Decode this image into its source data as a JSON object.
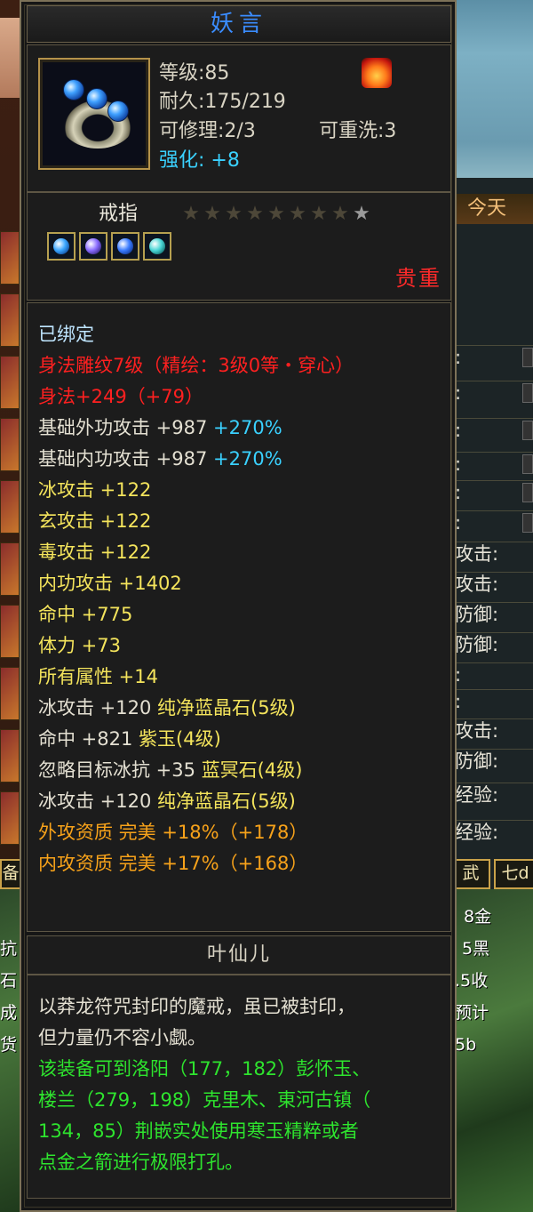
{
  "item": {
    "name": "妖言",
    "level_label": "等级:85",
    "durability_label": "耐久:175/219",
    "repair_label": "可修理:2/3",
    "rewash_label": "可重洗:3",
    "enhance_label": "强化:",
    "enhance_value": "+8",
    "type": "戒指",
    "star_rating": {
      "filled": 0,
      "total": 9
    },
    "rarity": "贵重",
    "socket_colors": [
      "#3aa6ff",
      "#8a6cff",
      "#3a7cff",
      "#4ad6d6"
    ]
  },
  "stats": {
    "bound": "已绑定",
    "engrave": "身法雕纹7级（精绘：3级0等・穿心）",
    "agility_base": "身法+249",
    "agility_bonus": "（+79）",
    "ext_atk_label": "基础外功攻击 +987",
    "ext_atk_pct": "+270%",
    "int_atk_label": "基础内功攻击 +987",
    "int_atk_pct": "+270%",
    "ice_atk": "冰攻击 +122",
    "mystic_atk": "玄攻击 +122",
    "poison_atk": "毒攻击 +122",
    "inner_atk": "内功攻击 +1402",
    "hit": "命中 +775",
    "stamina": "体力 +73",
    "all_attr": "所有属性 +14",
    "gem1_stat": "冰攻击 +120",
    "gem1_name": "纯净蓝晶石(5级)",
    "gem2_stat": "命中 +821",
    "gem2_name": "紫玉(4级)",
    "gem3_stat": "忽略目标冰抗 +35",
    "gem3_name": "蓝冥石(4级)",
    "gem4_stat": "冰攻击 +120",
    "gem4_name": "纯净蓝晶石(5级)",
    "ext_quality": "外攻资质  完美 +18%（+178）",
    "int_quality": "内攻资质  完美 +17%（+168）"
  },
  "owner": "叶仙儿",
  "description": {
    "line1": "以莽龙符咒封印的魔戒，虽已被封印，",
    "line2": "但力量仍不容小觑。",
    "green1": "该装备可到洛阳（177，182）彭怀玉、",
    "green2": "楼兰（279，198）克里木、東河古镇（",
    "green3": "134，85）荆嵌实处使用寒玉精粹或者",
    "green4": "点金之箭进行极限打孔。"
  },
  "background": {
    "title": "今天",
    "labels": [
      "攻击:",
      "攻击:",
      "防御:",
      "防御:",
      ":",
      ":",
      "攻击:",
      "防御:"
    ],
    "exp1": "经验:",
    "exp2": "经验:",
    "tab1": "武",
    "tab2": "七d",
    "left_tab": "备",
    "money1": "8金",
    "money2": "5黑",
    "money3": ".5收",
    "money4": "预计",
    "money5": "5b",
    "left1": "抗",
    "left2": "石",
    "left3": "成",
    "left4": "货"
  }
}
